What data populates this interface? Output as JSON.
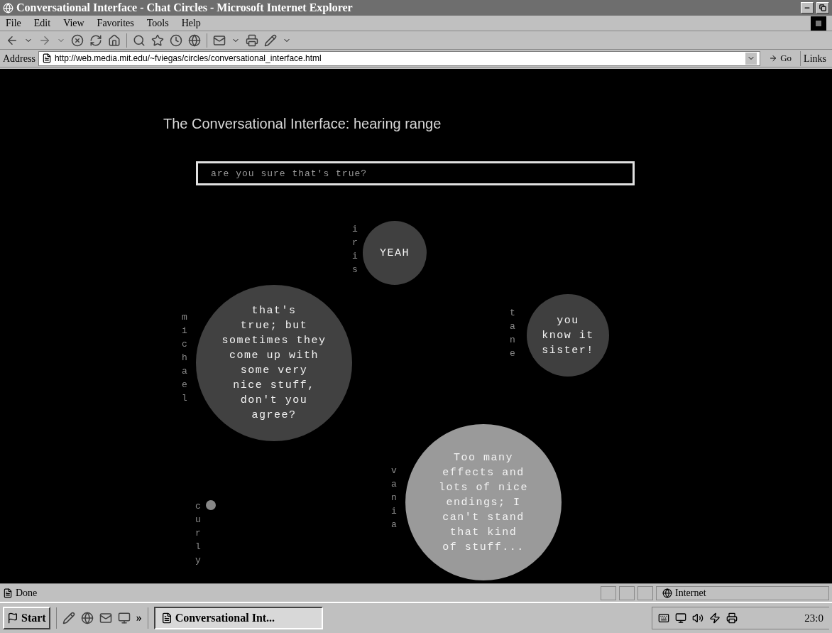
{
  "window": {
    "title": "Conversational Interface - Chat Circles - Microsoft Internet Explorer"
  },
  "menu": [
    "File",
    "Edit",
    "View",
    "Favorites",
    "Tools",
    "Help"
  ],
  "address_bar": {
    "label": "Address",
    "url": "http://web.media.mit.edu/~fviegas/circles/conversational_interface.html",
    "go": "Go",
    "links": "Links"
  },
  "page": {
    "heading": "The Conversational Interface: hearing range",
    "input": {
      "value": "are you sure that's true?"
    },
    "participants": [
      {
        "name": "iris",
        "message": "YEAH",
        "color": "#404040"
      },
      {
        "name": "michael",
        "message": "that's\ntrue; but\nsometimes they\ncome up with\nsome very\nnice stuff,\ndon't you\nagree?",
        "color": "#414141"
      },
      {
        "name": "tane",
        "message": "you\nknow it\nsister!",
        "color": "#3f3f3f"
      },
      {
        "name": "vania",
        "message": "Too many\neffects and\nlots of nice\nendings; I\ncan't stand\nthat kind\nof stuff...",
        "color": "#9a9a9a"
      },
      {
        "name": "curly",
        "color": "#888888"
      }
    ]
  },
  "status_bar": {
    "text": "Done",
    "zone": "Internet"
  },
  "taskbar": {
    "start": "Start",
    "more": "»",
    "task": "Conversational Int...",
    "clock": "23:0"
  }
}
